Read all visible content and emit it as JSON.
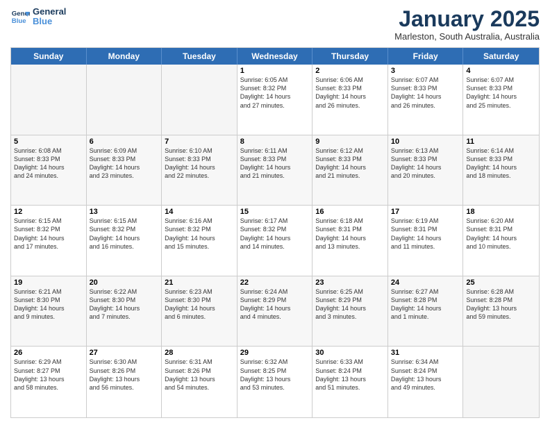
{
  "header": {
    "logo_line1": "General",
    "logo_line2": "Blue",
    "month_title": "January 2025",
    "location": "Marleston, South Australia, Australia"
  },
  "days_of_week": [
    "Sunday",
    "Monday",
    "Tuesday",
    "Wednesday",
    "Thursday",
    "Friday",
    "Saturday"
  ],
  "weeks": [
    [
      {
        "day": "",
        "info": "",
        "empty": true
      },
      {
        "day": "",
        "info": "",
        "empty": true
      },
      {
        "day": "",
        "info": "",
        "empty": true
      },
      {
        "day": "1",
        "info": "Sunrise: 6:05 AM\nSunset: 8:32 PM\nDaylight: 14 hours\nand 27 minutes.",
        "empty": false
      },
      {
        "day": "2",
        "info": "Sunrise: 6:06 AM\nSunset: 8:33 PM\nDaylight: 14 hours\nand 26 minutes.",
        "empty": false
      },
      {
        "day": "3",
        "info": "Sunrise: 6:07 AM\nSunset: 8:33 PM\nDaylight: 14 hours\nand 26 minutes.",
        "empty": false
      },
      {
        "day": "4",
        "info": "Sunrise: 6:07 AM\nSunset: 8:33 PM\nDaylight: 14 hours\nand 25 minutes.",
        "empty": false
      }
    ],
    [
      {
        "day": "5",
        "info": "Sunrise: 6:08 AM\nSunset: 8:33 PM\nDaylight: 14 hours\nand 24 minutes.",
        "empty": false
      },
      {
        "day": "6",
        "info": "Sunrise: 6:09 AM\nSunset: 8:33 PM\nDaylight: 14 hours\nand 23 minutes.",
        "empty": false
      },
      {
        "day": "7",
        "info": "Sunrise: 6:10 AM\nSunset: 8:33 PM\nDaylight: 14 hours\nand 22 minutes.",
        "empty": false
      },
      {
        "day": "8",
        "info": "Sunrise: 6:11 AM\nSunset: 8:33 PM\nDaylight: 14 hours\nand 21 minutes.",
        "empty": false
      },
      {
        "day": "9",
        "info": "Sunrise: 6:12 AM\nSunset: 8:33 PM\nDaylight: 14 hours\nand 21 minutes.",
        "empty": false
      },
      {
        "day": "10",
        "info": "Sunrise: 6:13 AM\nSunset: 8:33 PM\nDaylight: 14 hours\nand 20 minutes.",
        "empty": false
      },
      {
        "day": "11",
        "info": "Sunrise: 6:14 AM\nSunset: 8:33 PM\nDaylight: 14 hours\nand 18 minutes.",
        "empty": false
      }
    ],
    [
      {
        "day": "12",
        "info": "Sunrise: 6:15 AM\nSunset: 8:32 PM\nDaylight: 14 hours\nand 17 minutes.",
        "empty": false
      },
      {
        "day": "13",
        "info": "Sunrise: 6:15 AM\nSunset: 8:32 PM\nDaylight: 14 hours\nand 16 minutes.",
        "empty": false
      },
      {
        "day": "14",
        "info": "Sunrise: 6:16 AM\nSunset: 8:32 PM\nDaylight: 14 hours\nand 15 minutes.",
        "empty": false
      },
      {
        "day": "15",
        "info": "Sunrise: 6:17 AM\nSunset: 8:32 PM\nDaylight: 14 hours\nand 14 minutes.",
        "empty": false
      },
      {
        "day": "16",
        "info": "Sunrise: 6:18 AM\nSunset: 8:31 PM\nDaylight: 14 hours\nand 13 minutes.",
        "empty": false
      },
      {
        "day": "17",
        "info": "Sunrise: 6:19 AM\nSunset: 8:31 PM\nDaylight: 14 hours\nand 11 minutes.",
        "empty": false
      },
      {
        "day": "18",
        "info": "Sunrise: 6:20 AM\nSunset: 8:31 PM\nDaylight: 14 hours\nand 10 minutes.",
        "empty": false
      }
    ],
    [
      {
        "day": "19",
        "info": "Sunrise: 6:21 AM\nSunset: 8:30 PM\nDaylight: 14 hours\nand 9 minutes.",
        "empty": false
      },
      {
        "day": "20",
        "info": "Sunrise: 6:22 AM\nSunset: 8:30 PM\nDaylight: 14 hours\nand 7 minutes.",
        "empty": false
      },
      {
        "day": "21",
        "info": "Sunrise: 6:23 AM\nSunset: 8:30 PM\nDaylight: 14 hours\nand 6 minutes.",
        "empty": false
      },
      {
        "day": "22",
        "info": "Sunrise: 6:24 AM\nSunset: 8:29 PM\nDaylight: 14 hours\nand 4 minutes.",
        "empty": false
      },
      {
        "day": "23",
        "info": "Sunrise: 6:25 AM\nSunset: 8:29 PM\nDaylight: 14 hours\nand 3 minutes.",
        "empty": false
      },
      {
        "day": "24",
        "info": "Sunrise: 6:27 AM\nSunset: 8:28 PM\nDaylight: 14 hours\nand 1 minute.",
        "empty": false
      },
      {
        "day": "25",
        "info": "Sunrise: 6:28 AM\nSunset: 8:28 PM\nDaylight: 13 hours\nand 59 minutes.",
        "empty": false
      }
    ],
    [
      {
        "day": "26",
        "info": "Sunrise: 6:29 AM\nSunset: 8:27 PM\nDaylight: 13 hours\nand 58 minutes.",
        "empty": false
      },
      {
        "day": "27",
        "info": "Sunrise: 6:30 AM\nSunset: 8:26 PM\nDaylight: 13 hours\nand 56 minutes.",
        "empty": false
      },
      {
        "day": "28",
        "info": "Sunrise: 6:31 AM\nSunset: 8:26 PM\nDaylight: 13 hours\nand 54 minutes.",
        "empty": false
      },
      {
        "day": "29",
        "info": "Sunrise: 6:32 AM\nSunset: 8:25 PM\nDaylight: 13 hours\nand 53 minutes.",
        "empty": false
      },
      {
        "day": "30",
        "info": "Sunrise: 6:33 AM\nSunset: 8:24 PM\nDaylight: 13 hours\nand 51 minutes.",
        "empty": false
      },
      {
        "day": "31",
        "info": "Sunrise: 6:34 AM\nSunset: 8:24 PM\nDaylight: 13 hours\nand 49 minutes.",
        "empty": false
      },
      {
        "day": "",
        "info": "",
        "empty": true
      }
    ]
  ]
}
